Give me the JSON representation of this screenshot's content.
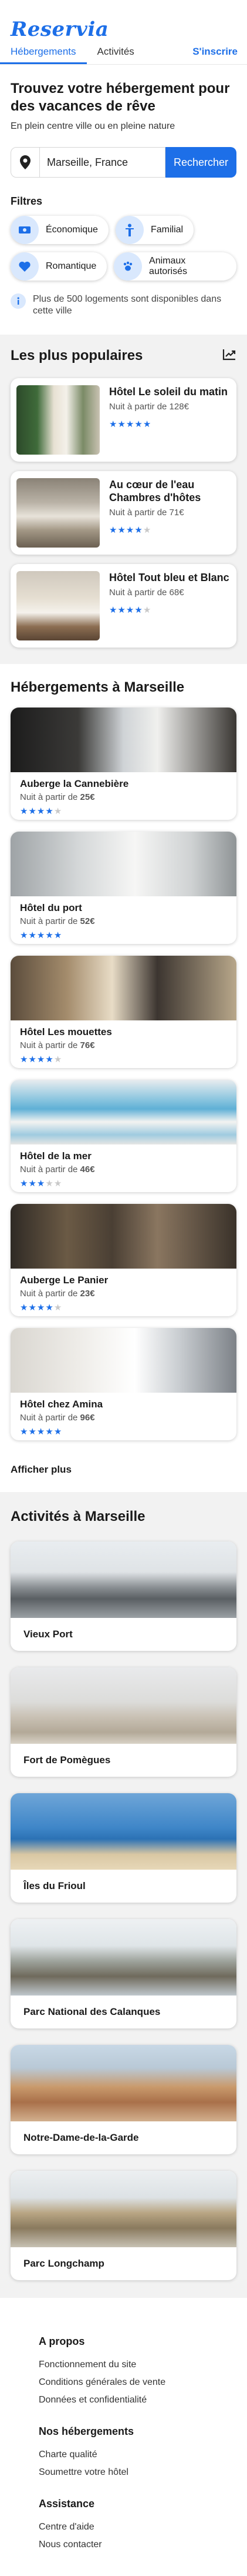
{
  "brand": {
    "logo": "Reservia",
    "accent": "#1d6fe8"
  },
  "nav": {
    "tabs": [
      "Hébergements",
      "Activités"
    ],
    "signup": "S'inscrire"
  },
  "hero": {
    "title": "Trouvez votre hébergement  pour des vacances de rêve",
    "subtitle": "En plein centre ville ou en pleine nature",
    "search_value": "Marseille, France",
    "search_button": "Rechercher"
  },
  "filters": {
    "title": "Filtres",
    "items": [
      "Économique",
      "Familial",
      "Romantique",
      "Animaux autorisés"
    ],
    "info": "Plus de 500 logements sont disponibles dans cette ville"
  },
  "popular": {
    "title": "Les plus populaires",
    "items": [
      {
        "name": "Hôtel Le soleil du matin",
        "price": "Nuit à partir de 128€",
        "rating": 5
      },
      {
        "name": "Au cœur de l'eau Chambres d'hôtes",
        "price": "Nuit à partir de 71€",
        "rating": 4
      },
      {
        "name": "Hôtel Tout bleu et Blanc",
        "price": "Nuit à partir de 68€",
        "rating": 4
      }
    ]
  },
  "hebergements": {
    "title": "Hébergements à Marseille",
    "items": [
      {
        "name": "Auberge la Cannebière",
        "price_prefix": "Nuit à partir de ",
        "price": "25€",
        "rating": 4
      },
      {
        "name": "Hôtel du port",
        "price_prefix": "Nuit à partir de ",
        "price": "52€",
        "rating": 5
      },
      {
        "name": "Hôtel Les mouettes",
        "price_prefix": "Nuit à partir de ",
        "price": "76€",
        "rating": 4
      },
      {
        "name": "Hôtel de la mer",
        "price_prefix": "Nuit à partir de ",
        "price": "46€",
        "rating": 3
      },
      {
        "name": "Auberge Le Panier",
        "price_prefix": "Nuit à partir de ",
        "price": "23€",
        "rating": 4
      },
      {
        "name": "Hôtel chez Amina",
        "price_prefix": "Nuit à partir de ",
        "price": "96€",
        "rating": 5
      }
    ],
    "more": "Afficher plus"
  },
  "activities": {
    "title": "Activités à Marseille",
    "items": [
      "Vieux Port",
      "Fort de Pomègues",
      "Îles du Frioul",
      "Parc National des Calanques",
      "Notre-Dame-de-la-Garde",
      "Parc Longchamp"
    ]
  },
  "footer": {
    "groups": [
      {
        "title": "A propos",
        "links": [
          "Fonctionnement du site",
          "Conditions générales de vente",
          "Données et confidentialité"
        ]
      },
      {
        "title": "Nos hébergements",
        "links": [
          "Charte qualité",
          "Soumettre votre hôtel"
        ]
      },
      {
        "title": "Assistance",
        "links": [
          "Centre d'aide",
          "Nous contacter"
        ]
      }
    ]
  }
}
